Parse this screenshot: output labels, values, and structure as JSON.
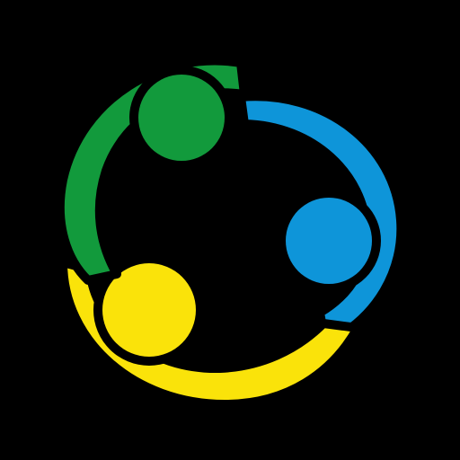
{
  "colors": {
    "background": "#000000",
    "green": "#129a3c",
    "blue": "#0e95d9",
    "yellow": "#fae30a",
    "outline": "#000000"
  },
  "logo": {
    "icon": "three-people-circle-logo-icon",
    "figures": [
      {
        "name": "green-figure",
        "color": "green"
      },
      {
        "name": "blue-figure",
        "color": "blue"
      },
      {
        "name": "yellow-figure",
        "color": "yellow"
      }
    ]
  }
}
